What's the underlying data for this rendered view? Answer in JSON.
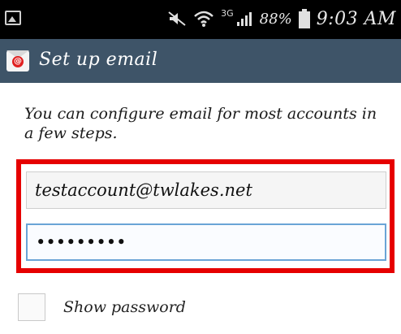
{
  "status_bar": {
    "left_icon": "image-notification-icon",
    "icons": [
      "mute-vibrate-icon",
      "wifi-icon",
      "signal-icon",
      "battery-icon"
    ],
    "network_label": "3G",
    "battery_percent": "88%",
    "time": "9:03 AM"
  },
  "app_bar": {
    "icon": "email-app-icon",
    "title": "Set up email"
  },
  "intro_text": "You can configure email for most accounts in a few steps.",
  "form": {
    "email_value": "testaccount@twlakes.net",
    "password_masked": "•••••••••",
    "highlight_color": "#e60000"
  },
  "show_password": {
    "label": "Show password",
    "checked": false
  }
}
